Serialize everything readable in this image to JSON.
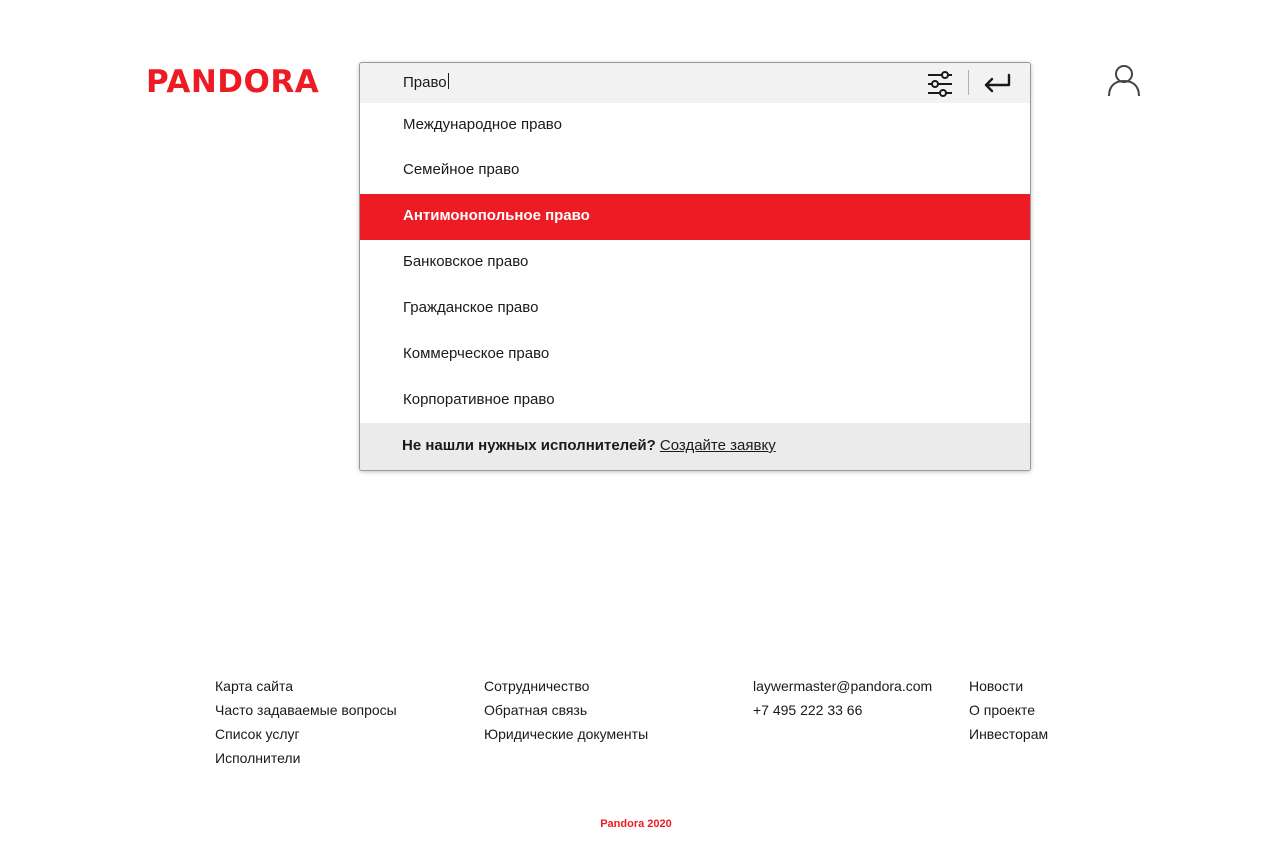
{
  "brand": {
    "logo_text": "PANDORA",
    "accent_color": "#ed1c24"
  },
  "search": {
    "query": "Право",
    "filter_icon": "sliders-icon",
    "enter_icon": "enter-arrow-icon",
    "suggestions": [
      "Международное право",
      "Семейное право",
      "Антимонопольное право",
      "Банковское право",
      "Гражданское право",
      "Коммерческое право",
      "Корпоративное право"
    ],
    "active_index": 2,
    "not_found": {
      "question": "Не нашли нужных исполнителей?",
      "link": "Создайте заявку"
    }
  },
  "user": {
    "icon": "user-icon"
  },
  "footer": {
    "col1": [
      "Карта сайта",
      "Часто задаваемые вопросы",
      "Список услуг",
      "Исполнители"
    ],
    "col2": [
      "Сотрудничество",
      "Обратная связь",
      "Юридические документы"
    ],
    "col3": [
      "laywermaster@pandora.com",
      "+7 495 222 33 66"
    ],
    "col4": [
      "Новости",
      "О проекте",
      "Инвесторам"
    ],
    "copyright": "Pandora 2020"
  }
}
